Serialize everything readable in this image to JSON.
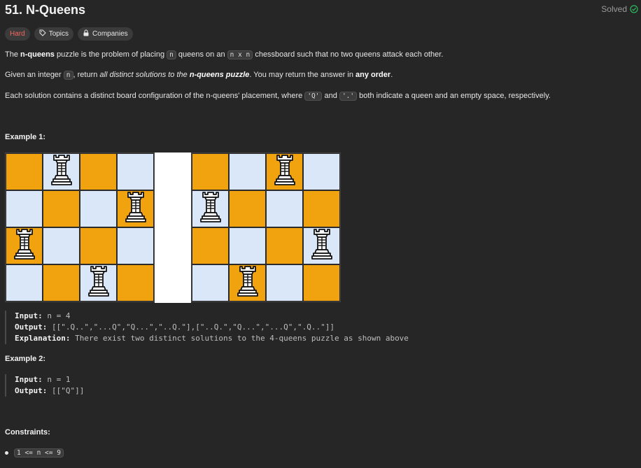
{
  "problem": {
    "title": "51. N-Queens",
    "status": "Solved",
    "difficulty": "Hard",
    "topics_label": "Topics",
    "companies_label": "Companies"
  },
  "description": {
    "p1_a": "The ",
    "p1_b": "n-queens",
    "p1_c": " puzzle is the problem of placing ",
    "p1_code1": "n",
    "p1_d": " queens on an ",
    "p1_code2": "n x n",
    "p1_e": " chessboard such that no two queens attack each other.",
    "p2_a": "Given an integer ",
    "p2_code": "n",
    "p2_b": ", return ",
    "p2_c": "all distinct solutions to the ",
    "p2_d": "n-queens puzzle",
    "p2_e": ". You may return the answer in ",
    "p2_f": "any order",
    "p2_g": ".",
    "p3_a": "Each solution contains a distinct board configuration of the n-queens' placement, where ",
    "p3_code1": "'Q'",
    "p3_b": " and ",
    "p3_code2": "'.'",
    "p3_c": " both indicate a queen and an empty space, respectively."
  },
  "example1": {
    "heading": "Example 1:",
    "boards": [
      {
        "queens": [
          1,
          3,
          0,
          2
        ]
      },
      {
        "queens": [
          2,
          0,
          3,
          1
        ]
      }
    ],
    "input_label": "Input:",
    "input_value": " n = 4",
    "output_label": "Output:",
    "output_value": " [[\".Q..\",\"...Q\",\"Q...\",\"..Q.\"],[\"..Q.\",\"Q...\",\"...Q\",\".Q..\"]]",
    "explanation_label": "Explanation:",
    "explanation_value": " There exist two distinct solutions to the 4-queens puzzle as shown above"
  },
  "example2": {
    "heading": "Example 2:",
    "input_label": "Input:",
    "input_value": " n = 1",
    "output_label": "Output:",
    "output_value": " [[\"Q\"]]"
  },
  "constraints": {
    "heading": "Constraints:",
    "items": [
      "1 <= n <= 9"
    ]
  },
  "colors": {
    "dark_square": "#f0a30f",
    "light_square": "#dae7f8",
    "hard": "#f7665e",
    "solved": "#2cbb5d"
  }
}
